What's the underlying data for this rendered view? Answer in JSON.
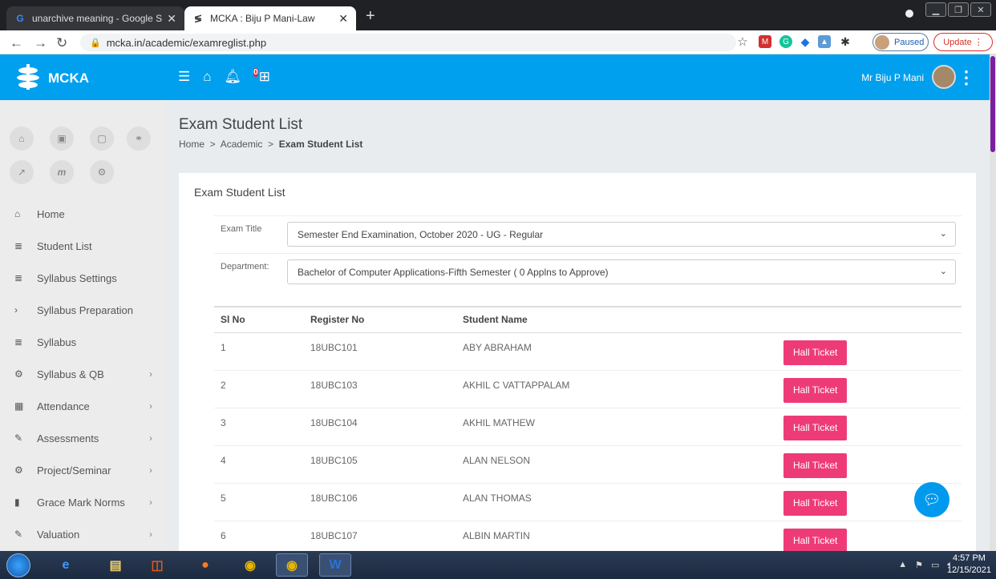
{
  "browser": {
    "tabs": [
      {
        "title": "unarchive meaning - Google Sea",
        "active": false
      },
      {
        "title": "MCKA : Biju P Mani-Law",
        "active": true
      }
    ],
    "url": "mcka.in/academic/examreglist.php",
    "profile_label": "Paused",
    "update_label": "Update"
  },
  "app": {
    "brand": "MCKA",
    "notification_count": "0",
    "user_name": "Mr Biju P Mani"
  },
  "sidebar": {
    "items": [
      {
        "label": "Home",
        "icon": "home-icon",
        "has_arrow": false
      },
      {
        "label": "Student List",
        "icon": "list-icon",
        "has_arrow": false
      },
      {
        "label": "Syllabus Settings",
        "icon": "list-icon",
        "has_arrow": false
      },
      {
        "label": "Syllabus Preparation",
        "icon": "chevron-right-icon",
        "has_arrow": false
      },
      {
        "label": "Syllabus",
        "icon": "list-icon",
        "has_arrow": false
      },
      {
        "label": "Syllabus & QB",
        "icon": "cogs-icon",
        "has_arrow": true
      },
      {
        "label": "Attendance",
        "icon": "calendar-icon",
        "has_arrow": true
      },
      {
        "label": "Assessments",
        "icon": "pencil-icon",
        "has_arrow": true
      },
      {
        "label": "Project/Seminar",
        "icon": "cogs-icon",
        "has_arrow": true
      },
      {
        "label": "Grace Mark Norms",
        "icon": "book-icon",
        "has_arrow": true
      },
      {
        "label": "Valuation",
        "icon": "pencil-icon",
        "has_arrow": true
      }
    ]
  },
  "page": {
    "title": "Exam Student List",
    "breadcrumb": [
      "Home",
      "Academic",
      "Exam Student List"
    ],
    "card_title": "Exam Student List",
    "filters": {
      "exam_title_label": "Exam Title",
      "exam_title_value": "Semester End Examination, October 2020 - UG - Regular",
      "department_label": "Department:",
      "department_value": "Bachelor of Computer Applications-Fifth Semester ( 0 Applns to Approve)"
    },
    "table": {
      "headers": [
        "Sl No",
        "Register No",
        "Student Name",
        ""
      ],
      "action_label": "Hall Ticket",
      "rows": [
        {
          "sl": "1",
          "reg": "18UBC101",
          "name": "ABY ABRAHAM"
        },
        {
          "sl": "2",
          "reg": "18UBC103",
          "name": "AKHIL C VATTAPPALAM"
        },
        {
          "sl": "3",
          "reg": "18UBC104",
          "name": "AKHIL MATHEW"
        },
        {
          "sl": "4",
          "reg": "18UBC105",
          "name": "ALAN NELSON"
        },
        {
          "sl": "5",
          "reg": "18UBC106",
          "name": "ALAN THOMAS"
        },
        {
          "sl": "6",
          "reg": "18UBC107",
          "name": "ALBIN MARTIN"
        }
      ]
    }
  },
  "taskbar": {
    "time": "4:57 PM",
    "date": "12/15/2021"
  },
  "colors": {
    "topbar": "#00a0ef",
    "button": "#ee3b77",
    "sidebar": "#ececec"
  }
}
